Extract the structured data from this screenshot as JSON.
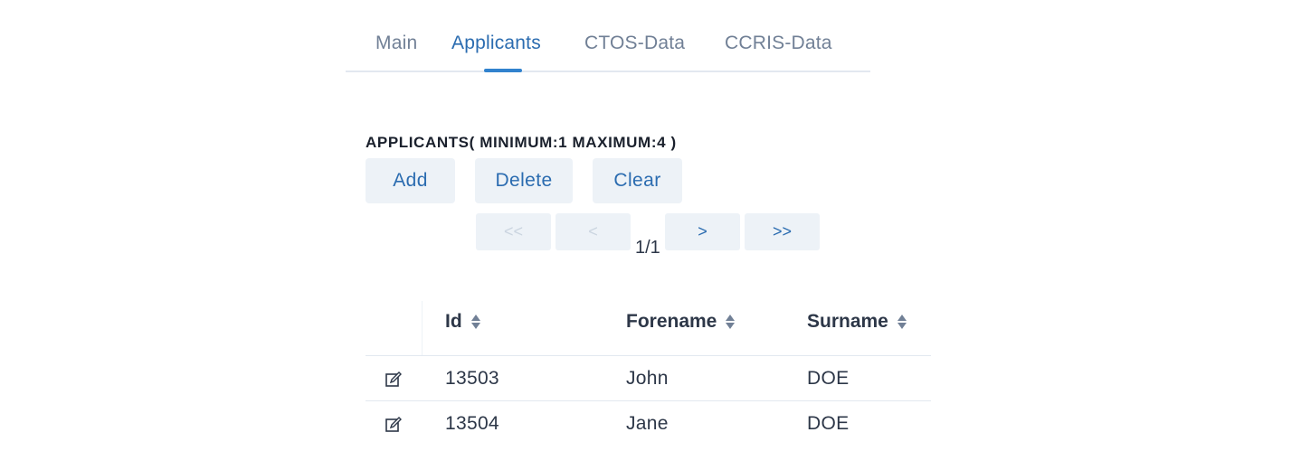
{
  "tabs": [
    {
      "label": "Main",
      "active": false
    },
    {
      "label": "Applicants",
      "active": true
    },
    {
      "label": "CTOS-Data",
      "active": false
    },
    {
      "label": "CCRIS-Data",
      "active": false
    }
  ],
  "section": {
    "label": "APPLICANTS( MINIMUM:1 MAXIMUM:4 )"
  },
  "actions": {
    "add": "Add",
    "delete": "Delete",
    "clear": "Clear"
  },
  "pager": {
    "first": "<<",
    "prev": "<",
    "next": ">",
    "last": ">>",
    "indicator": "1/1",
    "first_enabled": false,
    "prev_enabled": false,
    "next_enabled": true,
    "last_enabled": true
  },
  "table": {
    "columns": [
      "Id",
      "Forename",
      "Surname"
    ],
    "rows": [
      {
        "id": "13503",
        "forename": "John",
        "surname": "DOE",
        "icon": "edit-icon"
      },
      {
        "id": "13504",
        "forename": "Jane",
        "surname": "DOE",
        "icon": "edit-icon"
      }
    ]
  },
  "colors": {
    "accent": "#2b6cb0",
    "muted": "#718096",
    "button_bg": "#edf2f7",
    "disabled": "#cbd5e0"
  }
}
